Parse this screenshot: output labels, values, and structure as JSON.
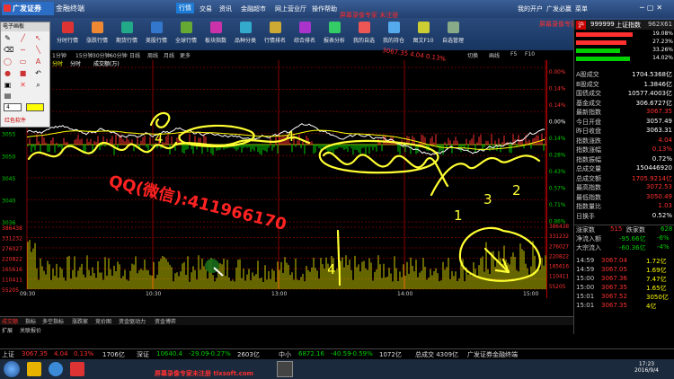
{
  "titlebar": {
    "brand": "广发证券",
    "app_name": "金融终端",
    "nav": [
      "行情",
      "交易",
      "资讯",
      "金融超市",
      "网上营业厅",
      "操作帮助"
    ],
    "active_nav": "行情",
    "watermark": "屏幕录像专家 未注册",
    "right_buttons": [
      "我的开户",
      "广发必赢",
      "菜单"
    ]
  },
  "toolbar": {
    "buttons": [
      "分时行情",
      "涨跌行情",
      "期货行情",
      "美股行情",
      "全球行情",
      "板块指数",
      "品种分类",
      "行情排名",
      "综合排名",
      "报表分析",
      "我的自选",
      "我的持仓",
      "图文F10",
      "自选管理"
    ],
    "red_text": "屏幕录像专家 未注册"
  },
  "pen_panel": {
    "title": "电子画板",
    "line_width": "4",
    "tool_label": "红色软件"
  },
  "chart_tabs": {
    "periods": [
      "1分钟",
      "15分钟",
      "30分钟",
      "60分钟",
      "日线",
      "周线",
      "月线",
      "更多"
    ],
    "left_tabs": [
      "分时",
      "分时",
      "成交额(万)"
    ],
    "right_tabs": [
      "切换",
      "画线",
      "F5",
      "F10"
    ],
    "overlay_text": "3067.35 4.04 0.13%"
  },
  "annotation": {
    "qq_text": "QQ(微信):411966170",
    "numbers": [
      "4",
      "4",
      "4",
      "1",
      "2",
      "3"
    ]
  },
  "axis": {
    "price_ticks": [
      "3068",
      "3063",
      "3059",
      "3055",
      "3050",
      "3045",
      "3040",
      "3036"
    ],
    "pct_ticks": [
      "0.00%",
      "0.14%",
      "0.14%",
      "0.00%",
      "0.14%",
      "0.28%",
      "0.43%",
      "0.57%",
      "0.71%",
      "0.86%"
    ],
    "volume_ticks": [
      "386438",
      "331232",
      "276027",
      "220822",
      "165616",
      "110411",
      "55205"
    ],
    "time_ticks": [
      "09:30",
      "10:30",
      "13:00",
      "14:00",
      "15:00"
    ]
  },
  "right_panel": {
    "header": {
      "code": "999999",
      "name": "上证指数",
      "suffix": "962X61"
    },
    "index_rows": [
      {
        "label": "A股成交",
        "value": "1704.5368亿"
      },
      {
        "label": "B股成交",
        "value": "1.3846亿"
      },
      {
        "label": "国债成交",
        "value": "10577.4003亿"
      },
      {
        "label": "基金成交",
        "value": "306.6727亿"
      },
      {
        "label": "最新指数",
        "value": "3067.35"
      },
      {
        "label": "今日开盘",
        "value": "3057.49"
      },
      {
        "label": "昨日收盘",
        "value": "3063.31"
      },
      {
        "label": "指数涨跌",
        "value": "4.04"
      },
      {
        "label": "指数涨幅",
        "value": "0.13%"
      },
      {
        "label": "指数振幅",
        "value": "0.72%"
      },
      {
        "label": "总成交量",
        "value": "150446920"
      },
      {
        "label": "总成交额",
        "value": "1705.9214亿"
      },
      {
        "label": "最高指数",
        "value": "3072.53"
      },
      {
        "label": "最低指数",
        "value": "3050.49"
      },
      {
        "label": "指数量比",
        "value": "1.03"
      },
      {
        "label": "日换手",
        "value": "0.52%"
      }
    ],
    "updown": {
      "up_label": "涨家数",
      "up": "515",
      "down_label": "跌家数",
      "down": "628"
    },
    "flows": [
      {
        "label": "净流入额",
        "value": "-95.66亿",
        "pct": "-6%"
      },
      {
        "label": "大宗流入",
        "value": "-60.36亿",
        "pct": "-4%"
      }
    ],
    "ticks": [
      {
        "time": "14:59",
        "price": "3067.04",
        "vol": "1.72亿"
      },
      {
        "time": "14:59",
        "price": "3067.05",
        "vol": "1.69亿"
      },
      {
        "time": "15:00",
        "price": "3067.36",
        "vol": "7.47亿"
      },
      {
        "time": "15:00",
        "price": "3067.35",
        "vol": "1.65亿"
      },
      {
        "time": "15:01",
        "price": "3067.52",
        "vol": "3050亿"
      },
      {
        "time": "15:01",
        "price": "3067.35",
        "vol": "4亿"
      }
    ]
  },
  "bottom_tabs": {
    "row1": [
      "成交额",
      "指标",
      "多空指标",
      "涨跌家",
      "竞价图",
      "资金驱动力",
      "资金博弈"
    ],
    "row2": [
      "扩展",
      "关联报价"
    ]
  },
  "status_bar": {
    "items": [
      {
        "name": "上证",
        "price": "3067.35",
        "change": "4.04",
        "pct": "0.13%",
        "amount": "1706亿"
      },
      {
        "name": "深证",
        "price": "10640.4",
        "change": "-29.09",
        "pct": "-0.27%",
        "amount": "2603亿"
      },
      {
        "name": "中小",
        "price": "6872.16",
        "change": "-40.59",
        "pct": "-0.59%",
        "amount": "1072亿"
      }
    ],
    "total": "总成交 4309亿",
    "broker": "广发证券金融终端"
  },
  "taskbar": {
    "registration": "屏幕录像专家未注册 tlxsoft.com",
    "time": "17:23",
    "date": "2016/9/4"
  },
  "colors": {
    "up": "#ff3030",
    "down": "#00d000",
    "price_line": "#ffffff",
    "avg_line": "#ffff00",
    "annotation": "#ffff33",
    "qq_text": "#ff2222"
  }
}
